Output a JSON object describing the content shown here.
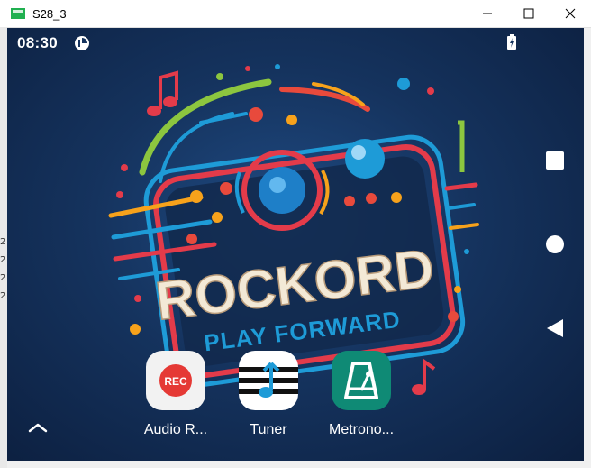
{
  "window": {
    "title": "S28_3"
  },
  "side_strip": {
    "lines": [
      "2",
      "2",
      "2",
      "2"
    ]
  },
  "status_bar": {
    "time": "08:30",
    "app_icon": "pie-chart-icon",
    "battery_icon": "battery-charging-icon"
  },
  "wallpaper": {
    "brand_name": "ROCKORD",
    "tagline": "PLAY FORWARD"
  },
  "apps": [
    {
      "label": "Audio R...",
      "icon": "record-icon",
      "icon_text": "REC",
      "icon_bg": "#f2f2f2",
      "accent": "#e53935"
    },
    {
      "label": "Tuner",
      "icon": "tuner-note-icon",
      "icon_bg": "#ffffff",
      "accent": "#1e9bd7"
    },
    {
      "label": "Metrono...",
      "icon": "metronome-icon",
      "icon_bg": "#0f8a75",
      "accent": "#ffffff"
    }
  ],
  "nav": {
    "recents": "square-icon",
    "home": "circle-icon",
    "back": "triangle-back-icon",
    "drawer": "chevron-up-icon"
  }
}
